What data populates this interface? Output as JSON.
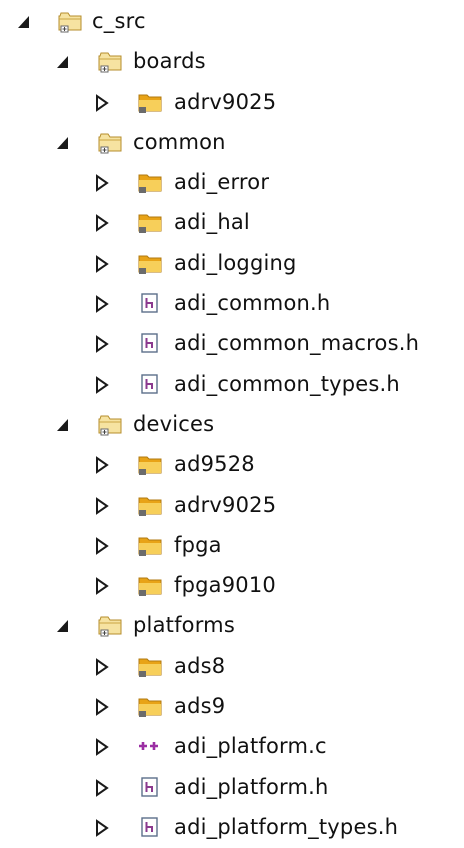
{
  "tree": [
    {
      "label": "c_src",
      "depth": 0,
      "expanded": true,
      "icon": "source-folder-icon"
    },
    {
      "label": "boards",
      "depth": 1,
      "expanded": true,
      "icon": "source-folder-icon"
    },
    {
      "label": "adrv9025",
      "depth": 2,
      "expanded": false,
      "icon": "folder-icon"
    },
    {
      "label": "common",
      "depth": 1,
      "expanded": true,
      "icon": "source-folder-icon"
    },
    {
      "label": "adi_error",
      "depth": 2,
      "expanded": false,
      "icon": "folder-icon"
    },
    {
      "label": "adi_hal",
      "depth": 2,
      "expanded": false,
      "icon": "folder-icon"
    },
    {
      "label": "adi_logging",
      "depth": 2,
      "expanded": false,
      "icon": "folder-icon"
    },
    {
      "label": "adi_common.h",
      "depth": 2,
      "expanded": false,
      "icon": "header-file-icon"
    },
    {
      "label": "adi_common_macros.h",
      "depth": 2,
      "expanded": false,
      "icon": "header-file-icon"
    },
    {
      "label": "adi_common_types.h",
      "depth": 2,
      "expanded": false,
      "icon": "header-file-icon"
    },
    {
      "label": "devices",
      "depth": 1,
      "expanded": true,
      "icon": "source-folder-icon"
    },
    {
      "label": "ad9528",
      "depth": 2,
      "expanded": false,
      "icon": "folder-icon"
    },
    {
      "label": "adrv9025",
      "depth": 2,
      "expanded": false,
      "icon": "folder-icon"
    },
    {
      "label": "fpga",
      "depth": 2,
      "expanded": false,
      "icon": "folder-icon"
    },
    {
      "label": "fpga9010",
      "depth": 2,
      "expanded": false,
      "icon": "folder-icon"
    },
    {
      "label": "platforms",
      "depth": 1,
      "expanded": true,
      "icon": "source-folder-icon"
    },
    {
      "label": "ads8",
      "depth": 2,
      "expanded": false,
      "icon": "folder-icon"
    },
    {
      "label": "ads9",
      "depth": 2,
      "expanded": false,
      "icon": "folder-icon"
    },
    {
      "label": "adi_platform.c",
      "depth": 2,
      "expanded": false,
      "icon": "c-source-file-icon"
    },
    {
      "label": "adi_platform.h",
      "depth": 2,
      "expanded": false,
      "icon": "header-file-icon"
    },
    {
      "label": "adi_platform_types.h",
      "depth": 2,
      "expanded": false,
      "icon": "header-file-icon"
    }
  ]
}
